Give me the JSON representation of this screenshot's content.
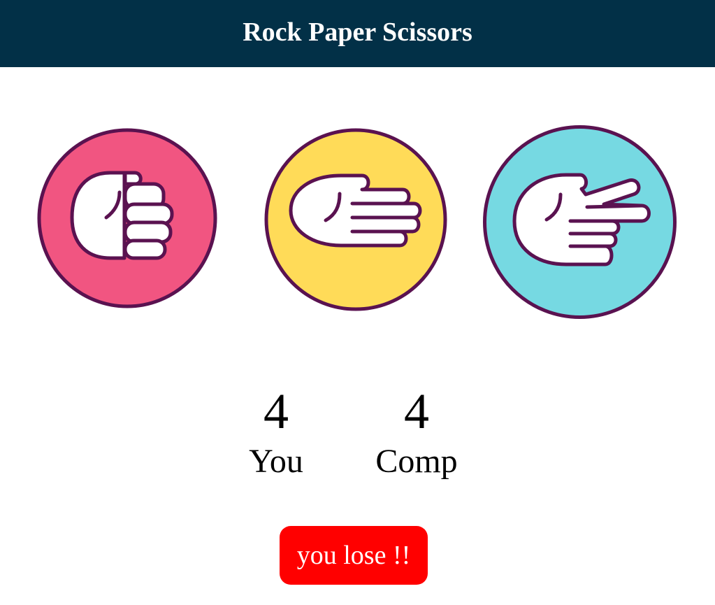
{
  "header": {
    "title": "Rock Paper Scissors"
  },
  "choices": [
    {
      "id": "rock",
      "icon": "rock-hand-icon",
      "color": "#F15581"
    },
    {
      "id": "paper",
      "icon": "paper-hand-icon",
      "color": "#FFDB58"
    },
    {
      "id": "scissors",
      "icon": "scissors-hand-icon",
      "color": "#76D9E2"
    }
  ],
  "outline_color": "#5A1250",
  "score": {
    "user": {
      "value": "4",
      "label": "You"
    },
    "comp": {
      "value": "4",
      "label": "Comp"
    }
  },
  "message": {
    "text": "you lose !!",
    "color": "#FF0000"
  },
  "colors": {
    "header_bg": "#023047",
    "header_text": "#FFFFFF"
  }
}
